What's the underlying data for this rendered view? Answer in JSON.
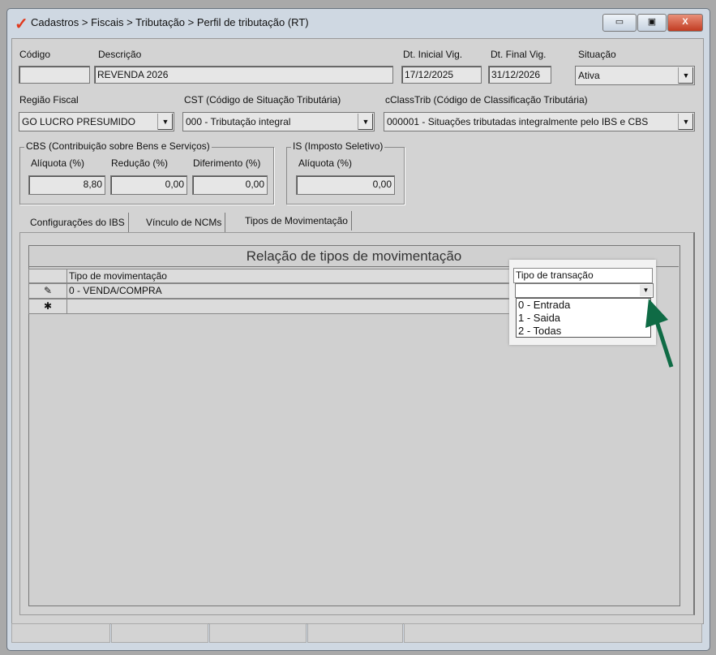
{
  "window": {
    "title": "Cadastros > Fiscais > Tributação > Perfil de tributação (RT)",
    "min": "▭",
    "max": "▣",
    "close": "X"
  },
  "form": {
    "codigo": {
      "label": "Código",
      "value": ""
    },
    "descricao": {
      "label": "Descrição",
      "value": "REVENDA 2026"
    },
    "dt_inicial": {
      "label": "Dt. Inicial Vig.",
      "value": "17/12/2025"
    },
    "dt_final": {
      "label": "Dt. Final Vig.",
      "value": "31/12/2026"
    },
    "situacao": {
      "label": "Situação",
      "value": "Ativa"
    },
    "regiao": {
      "label": "Região Fiscal",
      "value": "GO LUCRO PRESUMIDO"
    },
    "cst": {
      "label": "CST (Código de Situação Tributária)",
      "value": "000 - Tributação integral"
    },
    "cclasstrib": {
      "label": "cClassTrib (Código de Classificação Tributária)",
      "value": "000001 - Situações tributadas integralmente pelo IBS e CBS"
    },
    "cbs": {
      "title": "CBS (Contribuição sobre Bens e Serviços)",
      "aliquota_label": "Alíquota (%)",
      "aliquota": "8,80",
      "reducao_label": "Redução (%)",
      "reducao": "0,00",
      "diferimento_label": "Diferimento (%)",
      "diferimento": "0,00"
    },
    "is": {
      "title": "IS (Imposto Seletivo)",
      "aliquota_label": "Alíquota (%)",
      "aliquota": "0,00"
    }
  },
  "tabs": [
    {
      "label": "Configurações do IBS"
    },
    {
      "label": "Vínculo de NCMs"
    },
    {
      "label": "Tipos de Movimentação"
    }
  ],
  "grid": {
    "title": "Relação de tipos de movimentação",
    "col1": "Tipo de movimentação",
    "col2": "Tipo de transação",
    "rows": [
      {
        "indicator": "✎",
        "tipo": "0 - VENDA/COMPRA",
        "transacao": ""
      },
      {
        "indicator": "✱",
        "tipo": "",
        "transacao": ""
      }
    ],
    "options": [
      "0 - Entrada",
      "1 - Saida",
      "2 - Todas"
    ]
  },
  "colors": {
    "arrow": "#0f6b45",
    "logo": "#e03a1e"
  }
}
